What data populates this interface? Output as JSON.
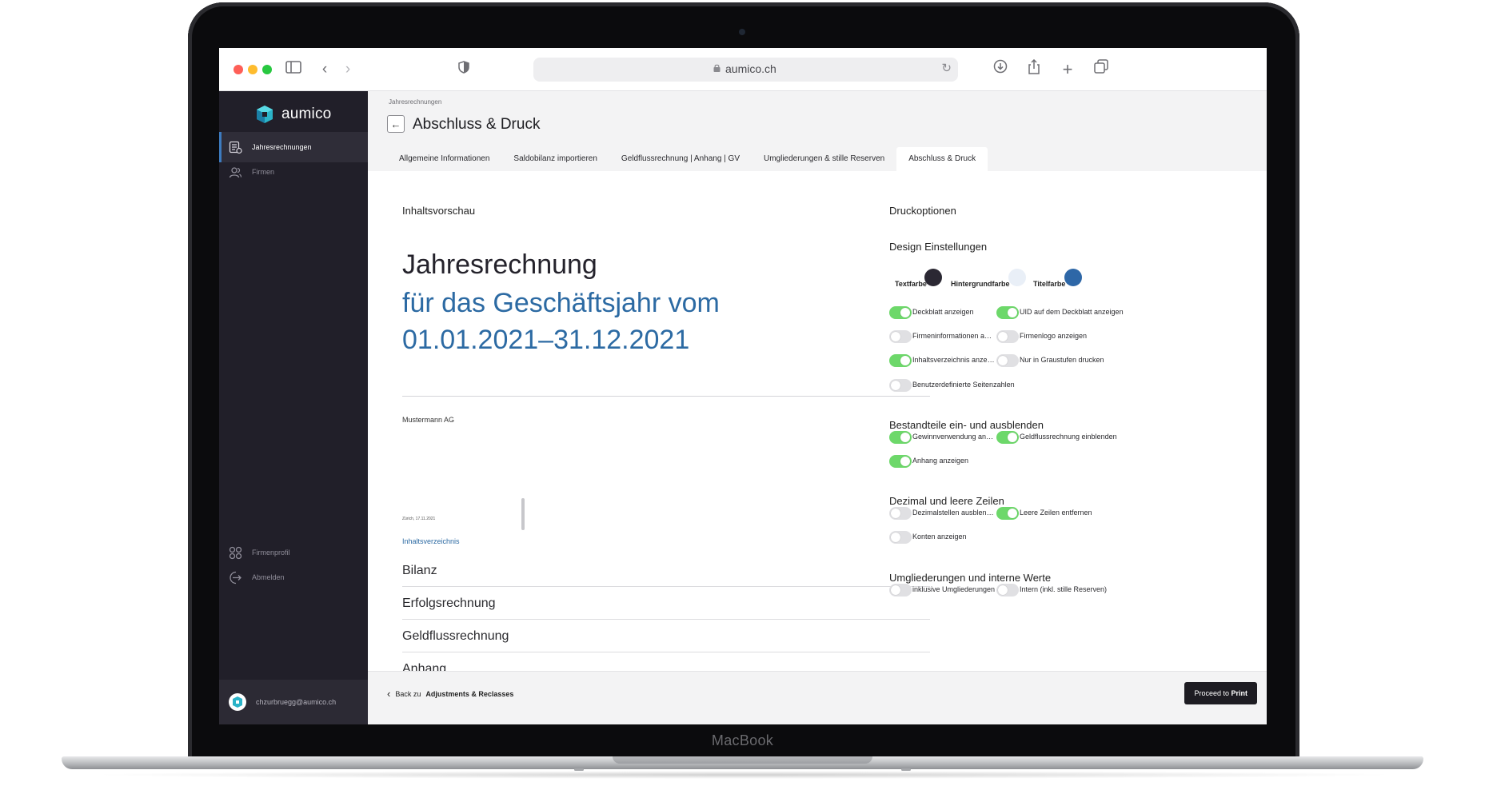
{
  "device": {
    "brand": "MacBook"
  },
  "browser": {
    "url": "aumico.ch"
  },
  "app": {
    "logo_text": "aumico",
    "sidebar": {
      "items": [
        {
          "label": "Jahresrechnungen",
          "icon": "document-list-icon",
          "active": true
        },
        {
          "label": "Firmen",
          "icon": "users-icon",
          "active": false
        }
      ],
      "bottom_items": [
        {
          "label": "Firmenprofil",
          "icon": "grid-icon"
        },
        {
          "label": "Abmelden",
          "icon": "logout-icon"
        }
      ],
      "user_email": "chzurbruegg@aumico.ch"
    },
    "breadcrumb": "Jahresrechnungen",
    "page_title": "Abschluss & Druck",
    "tabs": [
      "Allgemeine Informationen",
      "Saldobilanz importieren",
      "Geldflussrechnung | Anhang | GV",
      "Umgliederungen & stille Reserven",
      "Abschluss & Druck"
    ],
    "active_tab": 4
  },
  "preview": {
    "label": "Inhaltsvorschau",
    "title": "Jahresrechnung",
    "subtitle_line1": "für das Geschäftsjahr vom",
    "subtitle_line2": "01.01.2021–31.12.2021",
    "company": "Mustermann AG",
    "place_date": "Zürich, 17.11.2021",
    "toc_label": "Inhaltsverzeichnis",
    "toc": [
      "Bilanz",
      "Erfolgsrechnung",
      "Geldflussrechnung",
      "Anhang"
    ]
  },
  "options": {
    "heading": "Druckoptionen",
    "design": {
      "heading": "Design Einstellungen",
      "colors": [
        {
          "label": "Textfarbe",
          "color": "#2b2833"
        },
        {
          "label": "Hintergrundfarbe",
          "color": "#e9eff7"
        },
        {
          "label": "Titelfarbe",
          "color": "#2e67a7"
        }
      ],
      "toggles": [
        {
          "label": "Deckblatt anzeigen",
          "on": true
        },
        {
          "label": "UID auf dem Deckblatt anzeigen",
          "on": true
        },
        {
          "label": "Firmeninformationen anzeigen",
          "on": false
        },
        {
          "label": "Firmenlogo anzeigen",
          "on": false
        },
        {
          "label": "Inhaltsverzeichnis anzeigen",
          "on": true
        },
        {
          "label": "Nur in Graustufen drucken",
          "on": false
        },
        {
          "label": "Benutzerdefinierte Seitenzahlen",
          "on": false
        }
      ]
    },
    "components": {
      "heading": "Bestandteile ein- und ausblenden",
      "toggles": [
        {
          "label": "Gewinnverwendung anzeigen",
          "on": true
        },
        {
          "label": "Geldflussrechnung einblenden",
          "on": true
        },
        {
          "label": "Anhang anzeigen",
          "on": true
        }
      ]
    },
    "decimals": {
      "heading": "Dezimal und leere Zeilen",
      "toggles": [
        {
          "label": "Dezimalstellen ausblenden",
          "on": false
        },
        {
          "label": "Leere Zeilen entfernen",
          "on": true
        },
        {
          "label": "Konten anzeigen",
          "on": false
        }
      ]
    },
    "reclass": {
      "heading": "Umgliederungen und interne Werte",
      "toggles": [
        {
          "label": "inklusive Umgliederungen",
          "on": false
        },
        {
          "label": "Intern (inkl. stille Reserven)",
          "on": false
        }
      ]
    }
  },
  "footer": {
    "back_prefix": "Back zu",
    "back_target": "Adjustments & Reclasses",
    "proceed_prefix": "Proceed to",
    "proceed_target": "Print"
  }
}
